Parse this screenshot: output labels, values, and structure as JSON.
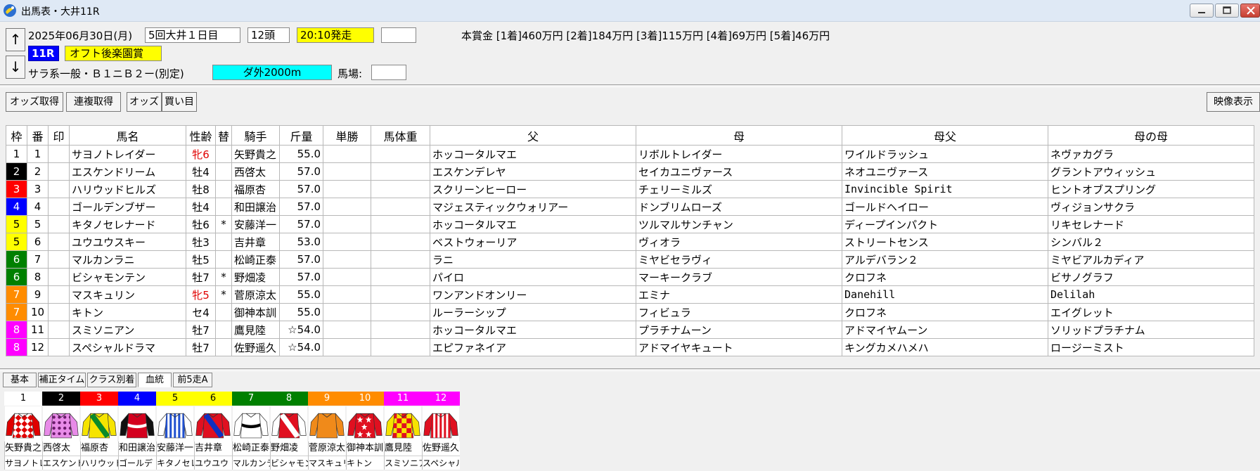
{
  "window": {
    "title": "出馬表・大井11R",
    "icons": [
      "app-icon",
      "minimize-icon",
      "maximize-icon",
      "close-icon"
    ]
  },
  "header": {
    "date": "2025年06月30日(月)",
    "meeting": "5回大井１日目",
    "heads": "12頭",
    "post_time": "20:10発走",
    "race_no": "11R",
    "race_name": "オフト後楽園賞",
    "race_class": "サラ系一般・Ｂ１ニＢ２ー(別定)",
    "course": "ダ外2000m",
    "baba_label": "馬場:",
    "baba_value": "",
    "prize": "本賞金 [1着]460万円 [2着]184万円 [3着]115万円 [4着]69万円 [5着]46万円",
    "nav_up": "↑",
    "nav_down": "↓"
  },
  "colors": {
    "post_time_bg": "#ffff00",
    "race_no_bg": "#0000ff",
    "race_name_bg": "#ffff00",
    "course_bg": "#00ffff",
    "frame": {
      "1": {
        "bg": "#ffffff",
        "fg": "#000000"
      },
      "2": {
        "bg": "#000000",
        "fg": "#ffffff"
      },
      "3": {
        "bg": "#ff0000",
        "fg": "#ffffff"
      },
      "4": {
        "bg": "#0000ff",
        "fg": "#ffffff"
      },
      "5": {
        "bg": "#ffff00",
        "fg": "#000000"
      },
      "6": {
        "bg": "#008000",
        "fg": "#ffffff"
      },
      "7": {
        "bg": "#ff8c00",
        "fg": "#ffffff"
      },
      "8": {
        "bg": "#ff00ff",
        "fg": "#ffffff"
      }
    }
  },
  "toolbar": {
    "odds_fetch": "オッズ取得",
    "renpuku_fetch": "連複取得",
    "odds": "オッズ",
    "kaime": "買い目",
    "video": "映像表示"
  },
  "table": {
    "columns": [
      "枠",
      "番",
      "印",
      "馬名",
      "性齢",
      "替",
      "騎手",
      "斤量",
      "単勝",
      "馬体重",
      "父",
      "母",
      "母父",
      "母の母"
    ],
    "rows": [
      {
        "waku": "1",
        "ban": "1",
        "mark": "",
        "name": "サヨノトレイダー",
        "sexage": "牝6",
        "sexage_red": true,
        "change": "",
        "jockey": "矢野貴之",
        "weight": "55.0",
        "odds": "",
        "bw": "",
        "sire": "ホッコータルマエ",
        "dam": "リボルトレイダー",
        "damsire": "ワイルドラッシュ",
        "damdam": "ネヴァカグラ"
      },
      {
        "waku": "2",
        "ban": "2",
        "mark": "",
        "name": "エスケンドリーム",
        "sexage": "牡4",
        "sexage_red": false,
        "change": "",
        "jockey": "西啓太",
        "weight": "57.0",
        "odds": "",
        "bw": "",
        "sire": "エスケンデレヤ",
        "dam": "セイカユニヴァース",
        "damsire": "ネオユニヴァース",
        "damdam": "グラントアウィッシュ"
      },
      {
        "waku": "3",
        "ban": "3",
        "mark": "",
        "name": "ハリウッドヒルズ",
        "sexage": "牡8",
        "sexage_red": false,
        "change": "",
        "jockey": "福原杏",
        "weight": "57.0",
        "odds": "",
        "bw": "",
        "sire": "スクリーンヒーロー",
        "dam": "チェリーミルズ",
        "damsire": "Invincible Spirit",
        "damdam": "ヒントオブスプリング"
      },
      {
        "waku": "4",
        "ban": "4",
        "mark": "",
        "name": "ゴールデンブザー",
        "sexage": "牡4",
        "sexage_red": false,
        "change": "",
        "jockey": "和田譲治",
        "weight": "57.0",
        "odds": "",
        "bw": "",
        "sire": "マジェスティックウォリアー",
        "dam": "ドンブリムローズ",
        "damsire": "ゴールドヘイロー",
        "damdam": "ヴィジョンサクラ"
      },
      {
        "waku": "5",
        "ban": "5",
        "mark": "",
        "name": "キタノセレナード",
        "sexage": "牡6",
        "sexage_red": false,
        "change": "*",
        "jockey": "安藤洋一",
        "weight": "57.0",
        "odds": "",
        "bw": "",
        "sire": "ホッコータルマエ",
        "dam": "ツルマルサンチャン",
        "damsire": "ディープインパクト",
        "damdam": "リキセレナード"
      },
      {
        "waku": "5",
        "ban": "6",
        "mark": "",
        "name": "ユウユウスキー",
        "sexage": "牡3",
        "sexage_red": false,
        "change": "",
        "jockey": "吉井章",
        "weight": "53.0",
        "odds": "",
        "bw": "",
        "sire": "ベストウォーリア",
        "dam": "ヴィオラ",
        "damsire": "ストリートセンス",
        "damdam": "シンバル２"
      },
      {
        "waku": "6",
        "ban": "7",
        "mark": "",
        "name": "マルカンラニ",
        "sexage": "牡5",
        "sexage_red": false,
        "change": "",
        "jockey": "松崎正泰",
        "weight": "57.0",
        "odds": "",
        "bw": "",
        "sire": "ラニ",
        "dam": "ミヤビセラヴィ",
        "damsire": "アルデバラン２",
        "damdam": "ミヤビアルカディア"
      },
      {
        "waku": "6",
        "ban": "8",
        "mark": "",
        "name": "ビシャモンテン",
        "sexage": "牡7",
        "sexage_red": false,
        "change": "*",
        "jockey": "野畑凌",
        "weight": "57.0",
        "odds": "",
        "bw": "",
        "sire": "パイロ",
        "dam": "マーキークラブ",
        "damsire": "クロフネ",
        "damdam": "ビサノグラフ"
      },
      {
        "waku": "7",
        "ban": "9",
        "mark": "",
        "name": "マスキュリン",
        "sexage": "牝5",
        "sexage_red": true,
        "change": "*",
        "jockey": "菅原涼太",
        "weight": "55.0",
        "odds": "",
        "bw": "",
        "sire": "ワンアンドオンリー",
        "dam": "エミナ",
        "damsire": "Danehill",
        "damdam": "Delilah"
      },
      {
        "waku": "7",
        "ban": "10",
        "mark": "",
        "name": "キトン",
        "sexage": "セ4",
        "sexage_red": false,
        "change": "",
        "jockey": "御神本訓",
        "weight": "55.0",
        "odds": "",
        "bw": "",
        "sire": "ルーラーシップ",
        "dam": "フィビュラ",
        "damsire": "クロフネ",
        "damdam": "エイグレット"
      },
      {
        "waku": "8",
        "ban": "11",
        "mark": "",
        "name": "スミソニアン",
        "sexage": "牡7",
        "sexage_red": false,
        "change": "",
        "jockey": "鷹見陸",
        "weight": "☆54.0",
        "odds": "",
        "bw": "",
        "sire": "ホッコータルマエ",
        "dam": "プラチナムーン",
        "damsire": "アドマイヤムーン",
        "damdam": "ソリッドプラチナム"
      },
      {
        "waku": "8",
        "ban": "12",
        "mark": "",
        "name": "スペシャルドラマ",
        "sexage": "牡7",
        "sexage_red": false,
        "change": "",
        "jockey": "佐野遥久",
        "weight": "☆54.0",
        "odds": "",
        "bw": "",
        "sire": "エピファネイア",
        "dam": "アドマイヤキュート",
        "damsire": "キングカメハメハ",
        "damdam": "ロージーミスト"
      }
    ]
  },
  "subtabs": [
    "基本",
    "補正タイム",
    "クラス別着",
    "血統",
    "前5走A"
  ],
  "active_subtab": "血統",
  "silks": [
    {
      "num": "1",
      "jockey": "矢野貴之",
      "horse": "サヨノトレ",
      "frame_bg": "#ffffff",
      "frame_fg": "#000000",
      "body": "#ffffff",
      "pattern": "#e00000",
      "sleeve": "#e00000",
      "type": "diamond"
    },
    {
      "num": "2",
      "jockey": "西啓太",
      "horse": "エスケンド",
      "frame_bg": "#000000",
      "frame_fg": "#ffffff",
      "body": "#e88be8",
      "pattern": "#6b1a6b",
      "sleeve": "#e88be8",
      "type": "dots"
    },
    {
      "num": "3",
      "jockey": "福原杏",
      "horse": "ハリウッド",
      "frame_bg": "#ff0000",
      "frame_fg": "#ffffff",
      "body": "#f6e400",
      "pattern": "#0a8a2a",
      "sleeve": "#f6e400",
      "type": "sash"
    },
    {
      "num": "4",
      "jockey": "和田譲治",
      "horse": "ゴールデ",
      "frame_bg": "#0000ff",
      "frame_fg": "#ffffff",
      "body": "#d4001e",
      "pattern": "#ffffff",
      "sleeve": "#101010",
      "type": "band"
    },
    {
      "num": "5",
      "jockey": "安藤洋一",
      "horse": "キタノセレ",
      "frame_bg": "#ffff00",
      "frame_fg": "#000000",
      "body": "#ffffff",
      "pattern": "#2050d0",
      "sleeve": "#ffffff",
      "type": "stripes"
    },
    {
      "num": "6",
      "jockey": "吉井章",
      "horse": "ユウユウ",
      "frame_bg": "#ffff00",
      "frame_fg": "#000000",
      "body": "#e01020",
      "pattern": "#1030c0",
      "sleeve": "#e01020",
      "type": "sash"
    },
    {
      "num": "7",
      "jockey": "松崎正泰",
      "horse": "マルカンラ",
      "frame_bg": "#008000",
      "frame_fg": "#ffffff",
      "body": "#ffffff",
      "pattern": "#000000",
      "sleeve": "#ffffff",
      "type": "band"
    },
    {
      "num": "8",
      "jockey": "野畑凌",
      "horse": "ビシャモン",
      "frame_bg": "#008000",
      "frame_fg": "#ffffff",
      "body": "#e01020",
      "pattern": "#ffffff",
      "sleeve": "#ffffff",
      "type": "sash"
    },
    {
      "num": "9",
      "jockey": "菅原涼太",
      "horse": "マスキュリ",
      "frame_bg": "#ff8c00",
      "frame_fg": "#ffffff",
      "body": "#f08a1a",
      "pattern": "#ffffff",
      "sleeve": "#f08a1a",
      "type": "plain"
    },
    {
      "num": "10",
      "jockey": "御神本訓",
      "horse": "キトン",
      "frame_bg": "#ff8c00",
      "frame_fg": "#ffffff",
      "body": "#e01020",
      "pattern": "#ffffff",
      "sleeve": "#e01020",
      "type": "stars"
    },
    {
      "num": "11",
      "jockey": "鷹見陸",
      "horse": "スミソニア",
      "frame_bg": "#ff00ff",
      "frame_fg": "#ffffff",
      "body": "#f6e400",
      "pattern": "#e01020",
      "sleeve": "#f6e400",
      "type": "checks"
    },
    {
      "num": "12",
      "jockey": "佐野遥久",
      "horse": "スペシャル",
      "frame_bg": "#ff00ff",
      "frame_fg": "#ffffff",
      "body": "#ffffff",
      "pattern": "#e01020",
      "sleeve": "#e01020",
      "type": "stripes"
    }
  ]
}
